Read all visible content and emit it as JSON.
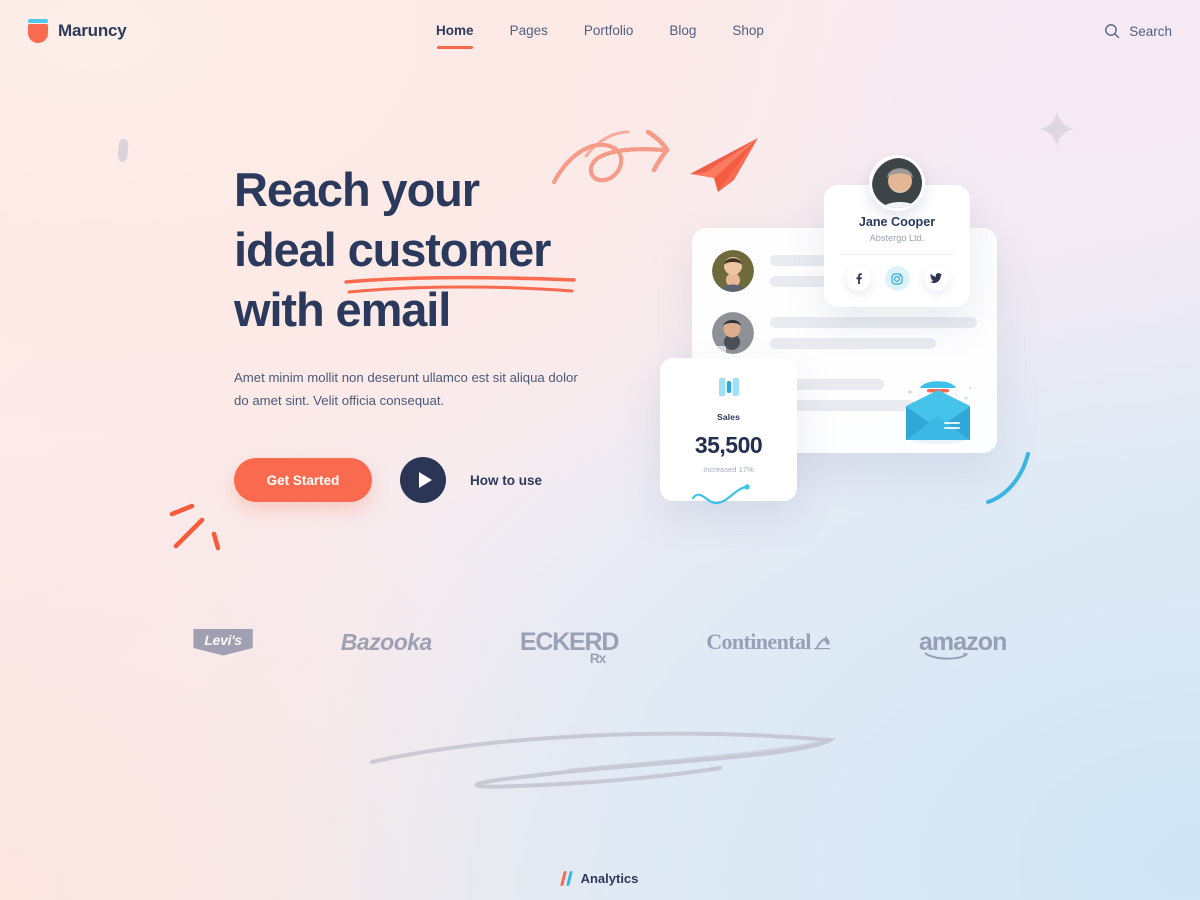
{
  "brand": {
    "name": "Maruncy",
    "mark_icon": "cup-logo-icon",
    "accent": "#f96a50",
    "accent_secondary": "#4ec9ea"
  },
  "nav": {
    "items": [
      {
        "label": "Home",
        "active": true
      },
      {
        "label": "Pages",
        "active": false
      },
      {
        "label": "Portfolio",
        "active": false
      },
      {
        "label": "Blog",
        "active": false
      },
      {
        "label": "Shop",
        "active": false
      }
    ]
  },
  "search": {
    "label": "Search",
    "icon": "search-icon"
  },
  "hero": {
    "headline_line1": "Reach your",
    "headline_line2_pre": "ideal ",
    "headline_line2_underlined": "customer",
    "headline_line3": "with email",
    "subcopy": "Amet minim mollit non deserunt ullamco est sit aliqua dolor do amet sint. Velit officia consequat.",
    "primary_cta": "Get Started",
    "video_cta": "How to use",
    "headline_color": "#2b3a5c",
    "underline_color": "#fa6a4e",
    "cta_color": "#fa6a4e"
  },
  "mockup": {
    "profile": {
      "name": "Jane Cooper",
      "company": "Abstergo Ltd.",
      "avatar": "profile-avatar-photo",
      "socials": [
        {
          "name": "facebook",
          "icon": "facebook-icon",
          "highlight": false
        },
        {
          "name": "instagram",
          "icon": "instagram-icon",
          "highlight": true
        },
        {
          "name": "twitter",
          "icon": "twitter-icon",
          "highlight": false
        }
      ]
    },
    "sales": {
      "icon": "bar-chart-icon",
      "label": "Sales",
      "value": "35,500",
      "subtext": "Increased 17%",
      "accent": "#3ec1e8"
    },
    "list_rows": [
      {
        "avatar": "contact-avatar-1"
      },
      {
        "avatar": "contact-avatar-2"
      },
      {
        "avatar": "contact-avatar-3"
      }
    ],
    "envelope_icon": "envelope-illustration"
  },
  "logos": {
    "items": [
      {
        "name": "levis",
        "label": "Levi's"
      },
      {
        "name": "bazooka",
        "label": "Bazooka"
      },
      {
        "name": "eckerd",
        "label": "ECKERD",
        "sub": "Rx"
      },
      {
        "name": "continental",
        "label": "Continental"
      },
      {
        "name": "amazon",
        "label": "amazon"
      }
    ]
  },
  "footer": {
    "label": "Analytics",
    "slash_colors": [
      "#f9674c",
      "#34b6e4"
    ]
  }
}
